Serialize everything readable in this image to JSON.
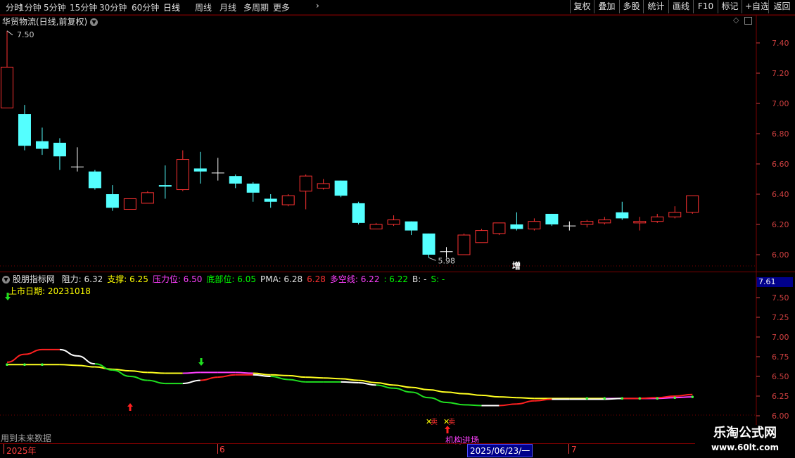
{
  "toolbar": {
    "periods": [
      "分时",
      "1分钟",
      "5分钟",
      "15分钟",
      "30分钟",
      "60分钟",
      "日线",
      "周线",
      "月线",
      "多周期",
      "更多"
    ],
    "more_arrow": "›",
    "buttons": [
      "复权",
      "叠加",
      "多股",
      "统计",
      "画线",
      "F10",
      "标记",
      "+自选",
      "返回"
    ]
  },
  "main_panel": {
    "title": "华贸物流(日线,前复权)",
    "high_marker": "7.50",
    "low_marker": "5.98",
    "zeng_label": "增",
    "y_ticks": [
      "7.40",
      "7.20",
      "7.00",
      "6.80",
      "6.60",
      "6.40",
      "6.20",
      "6.00"
    ],
    "colors": {
      "up": "#ff3232",
      "down": "#54ffff",
      "grid": "#7a0000"
    }
  },
  "indicator_panel": {
    "name": "股朋指标网",
    "values": [
      {
        "label": "阻力: 6.32",
        "color": "#e0e0e0"
      },
      {
        "label": "支撑: 6.25",
        "color": "#ffff00"
      },
      {
        "label": "压力位: 6.50",
        "color": "#ff40ff"
      },
      {
        "label": "底部位: 6.05",
        "color": "#00ff00"
      },
      {
        "label": "PMA: 6.28",
        "color": "#e0e0e0"
      },
      {
        "label": "6.28",
        "color": "#ff3232"
      },
      {
        "label": "多空线: 6.22",
        "color": "#ff40ff"
      },
      {
        "label": ": 6.22",
        "color": "#00ff00"
      },
      {
        "label": "B: -",
        "color": "#e0e0e0"
      },
      {
        "label": "S: -",
        "color": "#00ff00"
      }
    ],
    "listing_date": "上市日期: 20231018",
    "current_value": "7.61",
    "y_ticks": [
      "7.50",
      "7.25",
      "7.00",
      "6.75",
      "6.50",
      "6.25",
      "6.00"
    ],
    "sell_marks": [
      "卖",
      "卖"
    ],
    "institution_label": "机构进场",
    "future_data_note": "用到未来数据"
  },
  "time_axis": {
    "labels": [
      "2025年",
      "6",
      "2025/06/23/一",
      "7"
    ]
  },
  "watermark": {
    "title": "乐淘公式网",
    "url": "www.60lt.com"
  },
  "candles": [
    {
      "o": 6.97,
      "c": 7.24,
      "h": 7.48,
      "l": 6.97
    },
    {
      "o": 6.93,
      "c": 6.72,
      "h": 6.99,
      "l": 6.69
    },
    {
      "o": 6.75,
      "c": 6.7,
      "h": 6.84,
      "l": 6.66
    },
    {
      "o": 6.74,
      "c": 6.65,
      "h": 6.77,
      "l": 6.56
    },
    {
      "o": 6.58,
      "c": 6.58,
      "h": 6.71,
      "l": 6.55
    },
    {
      "o": 6.55,
      "c": 6.44,
      "h": 6.56,
      "l": 6.43
    },
    {
      "o": 6.4,
      "c": 6.31,
      "h": 6.46,
      "l": 6.29
    },
    {
      "o": 6.3,
      "c": 6.37,
      "h": 6.37,
      "l": 6.3
    },
    {
      "o": 6.34,
      "c": 6.41,
      "h": 6.42,
      "l": 6.34
    },
    {
      "o": 6.46,
      "c": 6.45,
      "h": 6.59,
      "l": 6.37
    },
    {
      "o": 6.43,
      "c": 6.63,
      "h": 6.69,
      "l": 6.42
    },
    {
      "o": 6.57,
      "c": 6.55,
      "h": 6.68,
      "l": 6.47
    },
    {
      "o": 6.54,
      "c": 6.54,
      "h": 6.64,
      "l": 6.49
    },
    {
      "o": 6.52,
      "c": 6.47,
      "h": 6.53,
      "l": 6.44
    },
    {
      "o": 6.47,
      "c": 6.41,
      "h": 6.48,
      "l": 6.35
    },
    {
      "o": 6.37,
      "c": 6.35,
      "h": 6.4,
      "l": 6.31
    },
    {
      "o": 6.33,
      "c": 6.39,
      "h": 6.4,
      "l": 6.32
    },
    {
      "o": 6.42,
      "c": 6.52,
      "h": 6.53,
      "l": 6.3
    },
    {
      "o": 6.44,
      "c": 6.47,
      "h": 6.5,
      "l": 6.43
    },
    {
      "o": 6.49,
      "c": 6.39,
      "h": 6.49,
      "l": 6.38
    },
    {
      "o": 6.34,
      "c": 6.21,
      "h": 6.35,
      "l": 6.2
    },
    {
      "o": 6.17,
      "c": 6.2,
      "h": 6.21,
      "l": 6.17
    },
    {
      "o": 6.2,
      "c": 6.23,
      "h": 6.26,
      "l": 6.19
    },
    {
      "o": 6.22,
      "c": 6.16,
      "h": 6.22,
      "l": 6.13
    },
    {
      "o": 6.14,
      "c": 6.0,
      "h": 6.14,
      "l": 5.98
    },
    {
      "o": 6.02,
      "c": 6.02,
      "h": 6.05,
      "l": 5.98
    },
    {
      "o": 6.0,
      "c": 6.13,
      "h": 6.14,
      "l": 6.0
    },
    {
      "o": 6.08,
      "c": 6.16,
      "h": 6.17,
      "l": 6.08
    },
    {
      "o": 6.14,
      "c": 6.21,
      "h": 6.21,
      "l": 6.13
    },
    {
      "o": 6.2,
      "c": 6.17,
      "h": 6.28,
      "l": 6.16
    },
    {
      "o": 6.17,
      "c": 6.22,
      "h": 6.24,
      "l": 6.16
    },
    {
      "o": 6.27,
      "c": 6.2,
      "h": 6.27,
      "l": 6.19
    },
    {
      "o": 6.19,
      "c": 6.19,
      "h": 6.22,
      "l": 6.16
    },
    {
      "o": 6.2,
      "c": 6.22,
      "h": 6.23,
      "l": 6.18
    },
    {
      "o": 6.21,
      "c": 6.23,
      "h": 6.25,
      "l": 6.2
    },
    {
      "o": 6.28,
      "c": 6.24,
      "h": 6.35,
      "l": 6.23
    },
    {
      "o": 6.21,
      "c": 6.22,
      "h": 6.25,
      "l": 6.16
    },
    {
      "o": 6.22,
      "c": 6.25,
      "h": 6.27,
      "l": 6.21
    },
    {
      "o": 6.25,
      "c": 6.28,
      "h": 6.32,
      "l": 6.24
    },
    {
      "o": 6.28,
      "c": 6.39,
      "h": 6.39,
      "l": 6.27
    }
  ],
  "indicator_lines": {
    "pma": [
      6.68,
      6.78,
      6.84,
      6.84,
      6.76,
      6.66,
      6.58,
      6.5,
      6.45,
      6.41,
      6.41,
      6.45,
      6.49,
      6.52,
      6.52,
      6.5,
      6.46,
      6.43,
      6.43,
      6.43,
      6.42,
      6.39,
      6.35,
      6.3,
      6.23,
      6.17,
      6.14,
      6.13,
      6.13,
      6.15,
      6.19,
      6.21,
      6.21,
      6.21,
      6.21,
      6.22,
      6.22,
      6.23,
      6.25,
      6.27
    ],
    "pma_colors": [
      "r",
      "r",
      "r",
      "w",
      "w",
      "g",
      "g",
      "g",
      "g",
      "g",
      "w",
      "r",
      "r",
      "r",
      "w",
      "g",
      "g",
      "g",
      "g",
      "w",
      "w",
      "g",
      "g",
      "g",
      "g",
      "g",
      "g",
      "w",
      "r",
      "r",
      "r",
      "w",
      "w",
      "w",
      "w",
      "r",
      "r",
      "r",
      "r",
      "r"
    ],
    "ma": [
      6.65,
      6.65,
      6.65,
      6.65,
      6.64,
      6.62,
      6.59,
      6.57,
      6.55,
      6.54,
      6.54,
      6.55,
      6.55,
      6.55,
      6.54,
      6.52,
      6.51,
      6.49,
      6.48,
      6.47,
      6.45,
      6.42,
      6.39,
      6.36,
      6.33,
      6.3,
      6.28,
      6.26,
      6.24,
      6.23,
      6.22,
      6.22,
      6.22,
      6.22,
      6.22,
      6.22,
      6.22,
      6.22,
      6.23,
      6.24
    ],
    "ma_colors": [
      "y",
      "y",
      "y",
      "y",
      "y",
      "y",
      "y",
      "y",
      "y",
      "y",
      "m",
      "m",
      "m",
      "m",
      "y",
      "y",
      "y",
      "y",
      "y",
      "y",
      "y",
      "y",
      "y",
      "y",
      "y",
      "y",
      "y",
      "y",
      "y",
      "y",
      "y",
      "y",
      "y",
      "y",
      "m",
      "m",
      "m",
      "m",
      "m",
      "m"
    ]
  }
}
